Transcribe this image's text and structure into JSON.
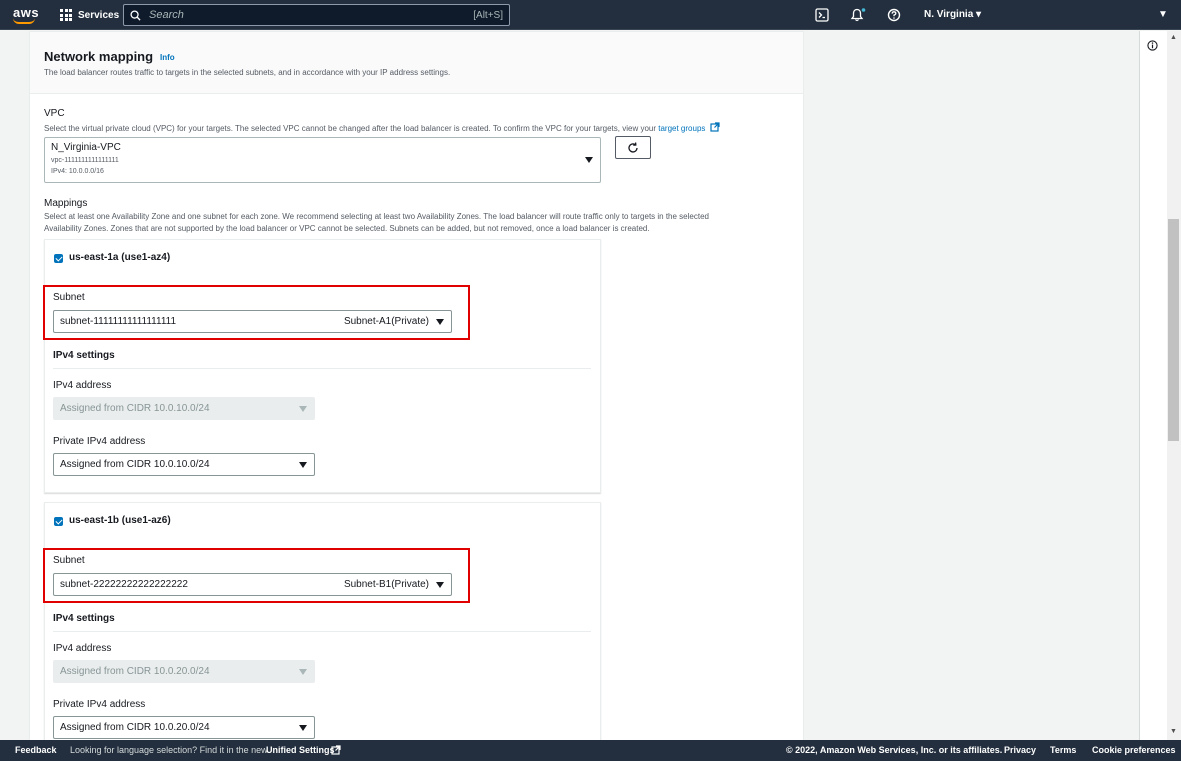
{
  "nav": {
    "logo_text": "aws",
    "services_label": "Services",
    "search_placeholder": "Search",
    "search_shortcut": "[Alt+S]",
    "region": "N. Virginia ▾"
  },
  "panel": {
    "title": "Network mapping",
    "info_label": "Info",
    "description": "The load balancer routes traffic to targets in the selected subnets, and in accordance with your IP address settings."
  },
  "vpc": {
    "label": "VPC",
    "description": "Select the virtual private cloud (VPC) for your targets. The selected VPC cannot be changed after the load balancer is created. To confirm the VPC for your targets, view your",
    "link_text": "target groups",
    "name": "N_Virginia-VPC",
    "id": "vpc-1111111111111111",
    "cidr": "IPv4: 10.0.0.0/16"
  },
  "mappings": {
    "label": "Mappings",
    "description_line1": "Select at least one Availability Zone and one subnet for each zone. We recommend selecting at least two Availability Zones. The load balancer will route traffic only to targets in the selected",
    "description_line2": "Availability Zones. Zones that are not supported by the load balancer or VPC cannot be selected. Subnets can be added, but not removed, once a load balancer is created.",
    "zones": [
      {
        "name": "us-east-1a (use1-az4)",
        "subnet_label": "Subnet",
        "subnet_value": "subnet-11111111111111111",
        "subnet_tag": "Subnet-A1(Private)",
        "ipv4_settings": "IPv4 settings",
        "ipv4_label": "IPv4 address",
        "ipv4_value": "Assigned from CIDR 10.0.10.0/24",
        "private_label": "Private IPv4 address",
        "private_value": "Assigned from CIDR 10.0.10.0/24"
      },
      {
        "name": "us-east-1b (use1-az6)",
        "subnet_label": "Subnet",
        "subnet_value": "subnet-22222222222222222",
        "subnet_tag": "Subnet-B1(Private)",
        "ipv4_settings": "IPv4 settings",
        "ipv4_label": "IPv4 address",
        "ipv4_value": "Assigned from CIDR 10.0.20.0/24",
        "private_label": "Private IPv4 address",
        "private_value": "Assigned from CIDR 10.0.20.0/24"
      }
    ]
  },
  "footer": {
    "feedback": "Feedback",
    "language_note": "Looking for language selection? Find it in the new",
    "unified_settings": "Unified Settings",
    "copyright": "© 2022, Amazon Web Services, Inc. or its affiliates.",
    "privacy": "Privacy",
    "terms": "Terms",
    "cookies": "Cookie preferences"
  },
  "colors": {
    "nav_bg": "#232f3e",
    "accent": "#0073bb",
    "highlight": "#e00000",
    "smile": "#ff9900"
  }
}
